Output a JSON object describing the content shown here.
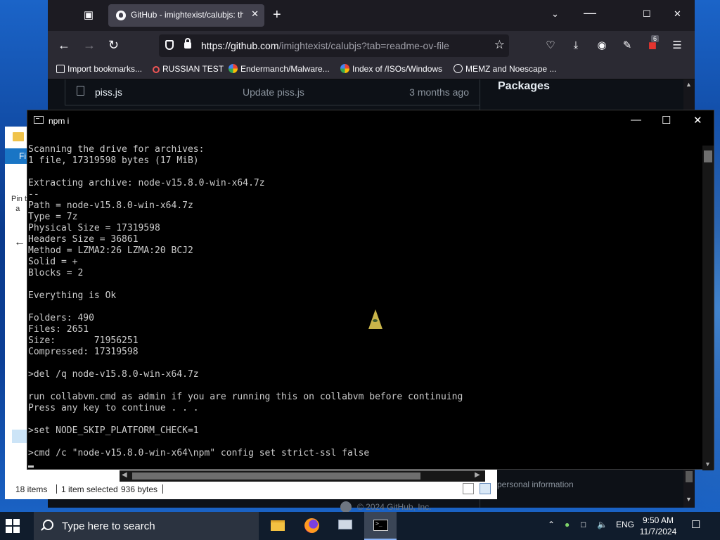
{
  "browser": {
    "tab_title": "GitHub - imightexist/calubjs: th",
    "url_host": "https://github.com",
    "url_path": "/imightexist/calubjs?tab=readme-ov-file",
    "badge_count": "6",
    "bookmarks": [
      {
        "label": "Import bookmarks...",
        "icon": "import-icon"
      },
      {
        "label": "RUSSIAN TEST",
        "icon": "spinner-icon"
      },
      {
        "label": "Endermanch/Malware...",
        "icon": "google-icon"
      },
      {
        "label": "Index of /ISOs/Windows",
        "icon": "google-icon"
      },
      {
        "label": "MEMZ and Noescape ...",
        "icon": "globe-icon"
      }
    ],
    "page": {
      "file_name": "piss.js",
      "commit_message": "Update piss.js",
      "commit_age": "3 months ago",
      "sidebar_heading": "Packages",
      "personal_info": "personal information",
      "footer": "© 2024 GitHub, Inc."
    }
  },
  "explorer": {
    "ribbon_label": "Fi",
    "pin_text": "Pin t\n  a",
    "status": {
      "items": "18 items",
      "selected": "1 item selected",
      "size": "936 bytes"
    }
  },
  "console": {
    "title": "npm i",
    "lines": [
      "Scanning the drive for archives:",
      "1 file, 17319598 bytes (17 MiB)",
      "",
      "Extracting archive: node-v15.8.0-win-x64.7z",
      "--",
      "Path = node-v15.8.0-win-x64.7z",
      "Type = 7z",
      "Physical Size = 17319598",
      "Headers Size = 36861",
      "Method = LZMA2:26 LZMA:20 BCJ2",
      "Solid = +",
      "Blocks = 2",
      "",
      "Everything is Ok",
      "",
      "Folders: 490",
      "Files: 2651",
      "Size:       71956251",
      "Compressed: 17319598",
      "",
      ">del /q node-v15.8.0-win-x64.7z",
      "",
      "run collabvm.cmd as admin if you are running this on collabvm before continuing",
      "Press any key to continue . . .",
      "",
      ">set NODE_SKIP_PLATFORM_CHECK=1",
      "",
      ">cmd /c \"node-v15.8.0-win-x64\\npm\" config set strict-ssl false"
    ]
  },
  "taskbar": {
    "search_placeholder": "Type here to search",
    "apps": [
      {
        "name": "file-explorer-icon"
      },
      {
        "name": "firefox-icon"
      },
      {
        "name": "computer-icon"
      },
      {
        "name": "console-icon",
        "active": true
      }
    ],
    "language": "ENG",
    "time": "9:50 AM",
    "date": "11/7/2024"
  }
}
